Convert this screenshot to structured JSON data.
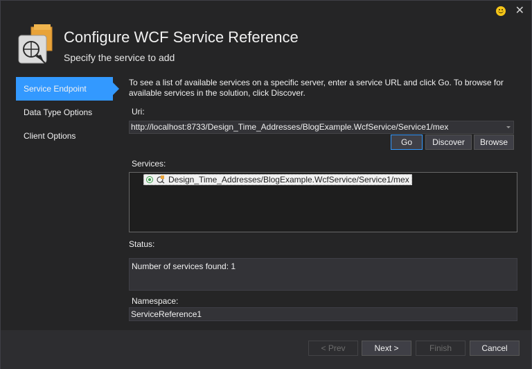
{
  "window": {
    "title": "Configure WCF Service Reference",
    "subtitle": "Specify the service to add"
  },
  "nav": {
    "items": [
      {
        "label": "Service Endpoint",
        "active": true
      },
      {
        "label": "Data Type Options",
        "active": false
      },
      {
        "label": "Client Options",
        "active": false
      }
    ]
  },
  "main": {
    "intro": "To see a list of available services on a specific server, enter a service URL and click Go. To browse for available services in the solution, click Discover.",
    "uri_label": "Uri:",
    "uri_value": "http://localhost:8733/Design_Time_Addresses/BlogExample.WcfService/Service1/mex",
    "go_label": "Go",
    "discover_label": "Discover",
    "browse_label": "Browse",
    "services_label": "Services:",
    "services": [
      {
        "label": "Design_Time_Addresses/BlogExample.WcfService/Service1/mex"
      }
    ],
    "status_label": "Status:",
    "status_text": "Number of services found: 1",
    "namespace_label": "Namespace:",
    "namespace_value": "ServiceReference1"
  },
  "footer": {
    "prev_label": "< Prev",
    "next_label": "Next >",
    "finish_label": "Finish",
    "cancel_label": "Cancel"
  },
  "colors": {
    "accent": "#3399ff",
    "background": "#252526",
    "input_bg": "#333337"
  },
  "icons": [
    "wcf-service-icon",
    "smiley-feedback-icon",
    "close-icon",
    "dropdown-arrow-icon",
    "radio-selected-icon",
    "service-item-icon"
  ]
}
